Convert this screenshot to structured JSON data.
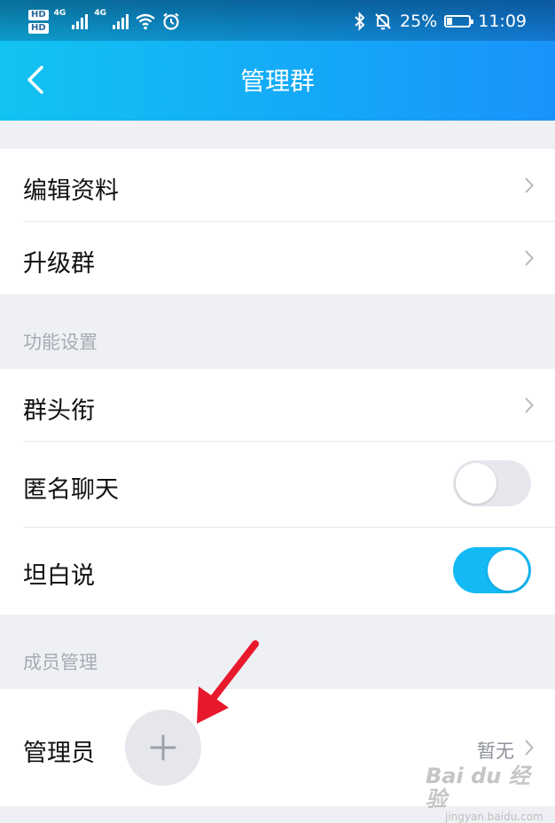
{
  "status_bar": {
    "hd1": "HD",
    "hd2": "HD",
    "net1": "4G",
    "net2": "4G",
    "battery": "25%",
    "battery_level": 0.25,
    "time": "11:09"
  },
  "nav": {
    "title": "管理群"
  },
  "section1": {
    "items": [
      {
        "label": "编辑资料"
      },
      {
        "label": "升级群"
      }
    ]
  },
  "section2": {
    "header": "功能设置",
    "items": [
      {
        "label": "群头衔"
      },
      {
        "label": "匿名聊天",
        "toggle": "off"
      },
      {
        "label": "坦白说",
        "toggle": "on"
      }
    ]
  },
  "section3": {
    "header": "成员管理",
    "items": [
      {
        "label": "管理员",
        "value": "暂无"
      }
    ]
  },
  "watermark": {
    "logo": "Bai du 经验",
    "sub": "jingyan.baidu.com"
  },
  "colors": {
    "accent": "#12b9f5",
    "header_start": "#12c3f2",
    "header_end": "#1993fb",
    "annotation_arrow": "#e8192c"
  }
}
